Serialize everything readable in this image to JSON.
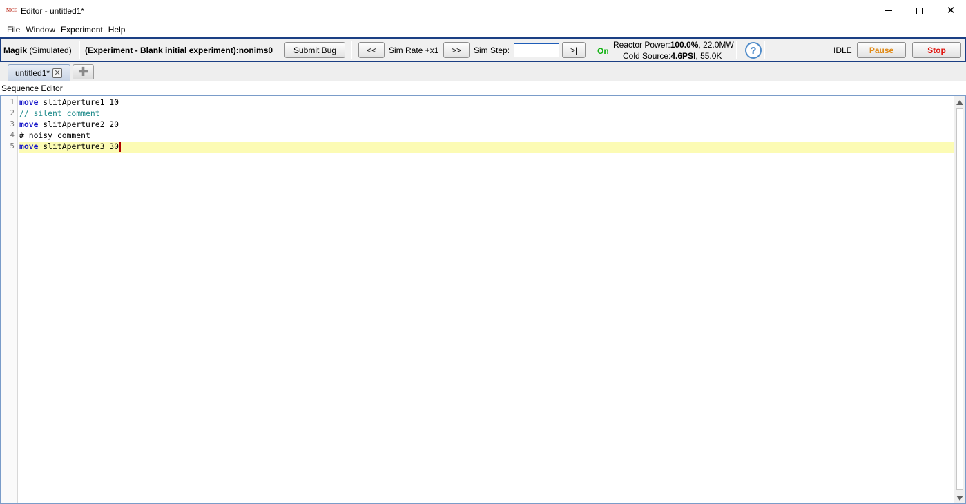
{
  "window": {
    "title": "Editor - untitled1*",
    "logo_text": "NICE"
  },
  "menu": [
    "File",
    "Window",
    "Experiment",
    "Help"
  ],
  "toolbar": {
    "instrument_name": "Magik",
    "instrument_mode": "(Simulated)",
    "experiment_label": "(Experiment - Blank initial experiment):",
    "experiment_id": "nonims0",
    "submit_bug": "Submit Bug",
    "rate_down": "<<",
    "sim_rate": "Sim Rate +x1",
    "rate_up": ">>",
    "sim_step_label": "Sim Step:",
    "sim_step_value": "",
    "step_button": ">|",
    "status_on": "On",
    "reactor_power_label": "Reactor Power:",
    "reactor_power_value": "100.0%",
    "reactor_power_mw": ", 22.0MW",
    "cold_source_label": "Cold Source:",
    "cold_source_psi": "4.6PSI",
    "cold_source_k": ", 55.0K",
    "help": "?",
    "state": "IDLE",
    "pause": "Pause",
    "stop": "Stop",
    "colors": {
      "on": "#12b312",
      "pause": "#e08a16",
      "stop": "#e0140e"
    }
  },
  "tabs": [
    {
      "label": "untitled1*",
      "close_icon": "close-x-icon"
    }
  ],
  "section_label": "Sequence Editor",
  "editor": {
    "lines": [
      {
        "num": "1",
        "kw": "move",
        "rest": " slitAperture1 10"
      },
      {
        "num": "2",
        "comment": "// silent comment"
      },
      {
        "num": "3",
        "kw": "move",
        "rest": " slitAperture2 20"
      },
      {
        "num": "4",
        "text": "# noisy comment"
      },
      {
        "num": "5",
        "kw": "move",
        "rest": " slitAperture3 30"
      }
    ]
  }
}
